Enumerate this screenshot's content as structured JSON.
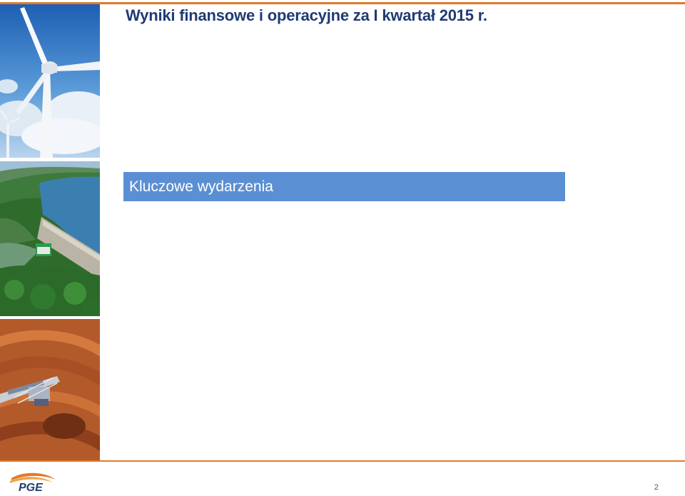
{
  "slide": {
    "title": "Wyniki finansowe i operacyjne za I kwartał 2015 r.",
    "section_title": "Kluczowe wydarzenia",
    "page_number": "2"
  },
  "logo": {
    "text": "PGE"
  },
  "colors": {
    "accent_orange": "#e07a2b",
    "title_navy": "#1f3b73",
    "section_blue": "#5b8fd3"
  },
  "images": [
    "wind-turbines-photo",
    "dam-lake-photo",
    "mine-excavator-photo"
  ]
}
